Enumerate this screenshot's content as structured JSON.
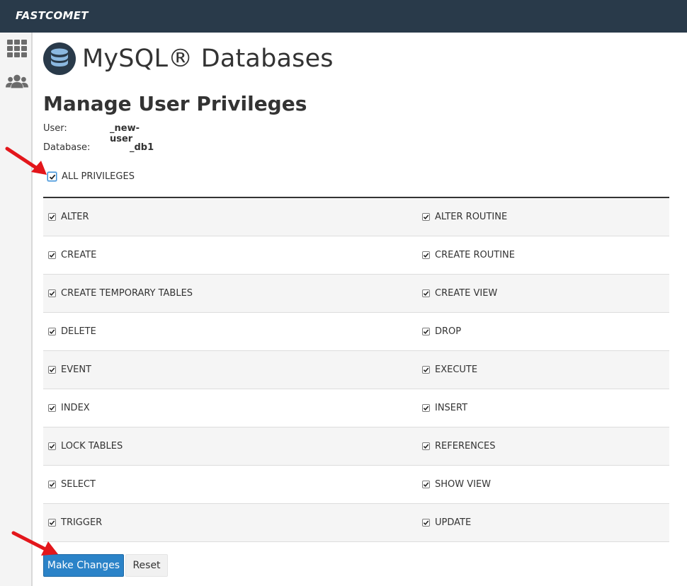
{
  "topbar": {
    "logo_text": "FASTCOMET"
  },
  "sidebar": {
    "icons": [
      "grid-icon",
      "users-icon"
    ]
  },
  "header": {
    "title": "MySQL® Databases",
    "icon": "database-icon"
  },
  "section": {
    "title": "Manage User Privileges",
    "user_label": "User:",
    "user_value": "_new-user",
    "database_label": "Database:",
    "database_value": "_db1"
  },
  "all_privileges": {
    "label": "ALL PRIVILEGES",
    "checked": true
  },
  "privileges": [
    [
      "ALTER",
      "ALTER ROUTINE"
    ],
    [
      "CREATE",
      "CREATE ROUTINE"
    ],
    [
      "CREATE TEMPORARY TABLES",
      "CREATE VIEW"
    ],
    [
      "DELETE",
      "DROP"
    ],
    [
      "EVENT",
      "EXECUTE"
    ],
    [
      "INDEX",
      "INSERT"
    ],
    [
      "LOCK TABLES",
      "REFERENCES"
    ],
    [
      "SELECT",
      "SHOW VIEW"
    ],
    [
      "TRIGGER",
      "UPDATE"
    ]
  ],
  "buttons": {
    "make_changes": "Make Changes",
    "reset": "Reset"
  },
  "colors": {
    "topbar": "#293a4a",
    "primary": "#2b83c8",
    "annotation_arrow": "#e3161b"
  }
}
